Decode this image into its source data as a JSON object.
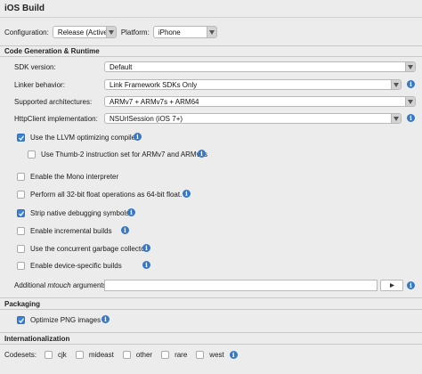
{
  "window": {
    "title": "iOS Build"
  },
  "config": {
    "configuration_label": "Configuration:",
    "configuration_value": "Release (Active)",
    "platform_label": "Platform:",
    "platform_value": "iPhone"
  },
  "codegen": {
    "heading": "Code Generation & Runtime",
    "sdk_label": "SDK version:",
    "sdk_value": "Default",
    "linker_label": "Linker behavior:",
    "linker_value": "Link Framework SDKs Only",
    "arch_label": "Supported architectures:",
    "arch_value": "ARMv7 + ARMv7s + ARM64",
    "http_label": "HttpClient implementation:",
    "http_value": "NSUrlSession (iOS 7+)",
    "llvm_label": "Use the LLVM optimizing compiler",
    "llvm_checked": true,
    "thumb_label": "Use Thumb-2 instruction set for ARMv7 and ARMv7s",
    "thumb_checked": false,
    "mono_interp_label": "Enable the Mono interpreter",
    "mono_interp_checked": false,
    "float_label": "Perform all 32-bit float operations as 64-bit float.",
    "float_checked": false,
    "strip_label": "Strip native debugging symbols",
    "strip_checked": true,
    "incremental_label": "Enable incremental builds",
    "incremental_checked": false,
    "gc_label": "Use the concurrent garbage collector",
    "gc_checked": false,
    "device_label": "Enable device-specific builds",
    "device_checked": false,
    "mtouch_prefix": "Additional ",
    "mtouch_italic": "mtouch",
    "mtouch_suffix": " arguments:",
    "mtouch_value": ""
  },
  "packaging": {
    "heading": "Packaging",
    "png_label": "Optimize PNG images",
    "png_checked": true
  },
  "i18n": {
    "heading": "Internationalization",
    "codesets_label": "Codesets:",
    "codesets": [
      "cjk",
      "mideast",
      "other",
      "rare",
      "west"
    ]
  },
  "colors": {
    "accent": "#3a82d8",
    "info": "#3478c6"
  }
}
